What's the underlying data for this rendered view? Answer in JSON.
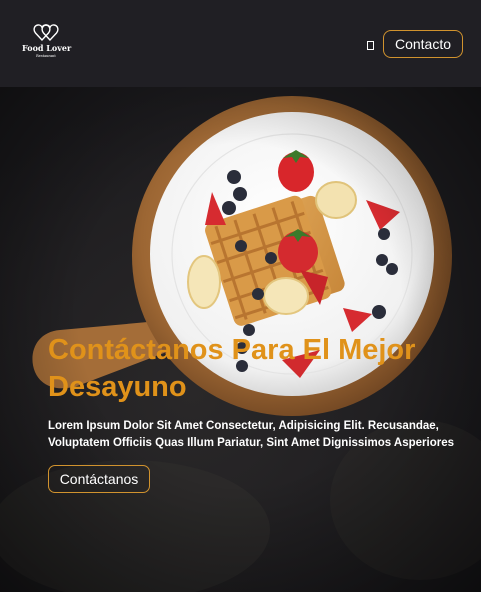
{
  "header": {
    "logo_name": "Food Lover",
    "logo_sub": "Restaurant",
    "contact_label": "Contacto"
  },
  "hero": {
    "title": "Contáctanos Para El Mejor Desayuno",
    "description": "Lorem Ipsum Dolor Sit Amet Consectetur, Adipisicing Elit. Recusandae, Voluptatem Officiis Quas Illum Pariatur, Sint Amet Dignissimos Asperiores",
    "button_label": "Contáctanos"
  },
  "colors": {
    "accent": "#e0921a",
    "header_bg": "#201f24",
    "hero_bg": "#232126"
  },
  "icons": {
    "logo": "heart-logo-icon",
    "menu": "menu-toggle-icon"
  }
}
